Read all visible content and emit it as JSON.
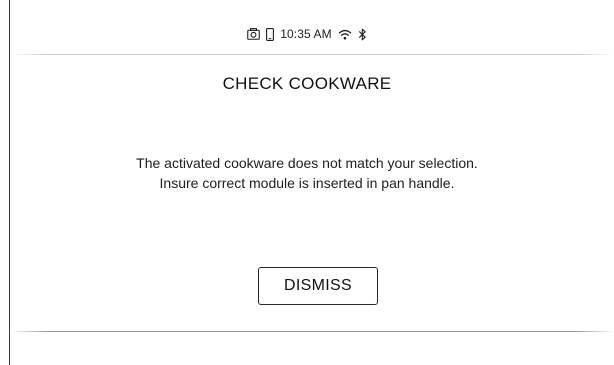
{
  "status_bar": {
    "time": "10:35 AM",
    "icons": [
      "camera-icon",
      "phone-icon",
      "wifi-icon",
      "bluetooth-icon"
    ]
  },
  "dialog": {
    "title": "CHECK COOKWARE",
    "message_lines": [
      "The activated cookware does not match your selection.",
      "Insure correct module is inserted in pan handle."
    ],
    "dismiss_label": "DISMISS"
  },
  "colors": {
    "background": "#ffffff",
    "text": "#1a1a1a",
    "border": "#2a2a2a"
  }
}
